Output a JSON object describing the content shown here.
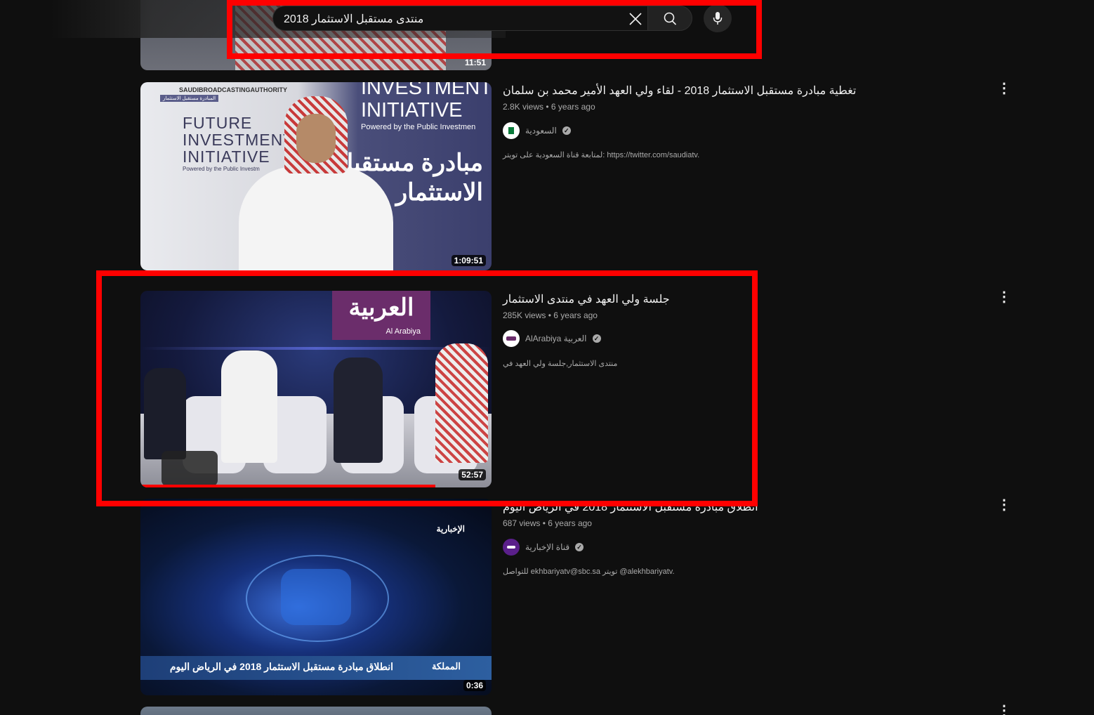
{
  "search": {
    "query": "منتدى مستقبل الاستثمار 2018",
    "clear_icon": "close-icon",
    "search_icon": "search-icon",
    "mic_icon": "microphone-icon"
  },
  "results": [
    {
      "duration": "11:51"
    },
    {
      "title": "تغطية مبادرة مستقبل الاستثمار 2018 - لقاء ولي العهد الأمير محمد بن سلمان",
      "views": "2.8K views",
      "age": "6 years ago",
      "channel": "السعودية",
      "description": "لمتابعة قناة السعودية على تويتر: https://twitter.com/saudiatv.",
      "duration": "1:09:51",
      "thumb_text": {
        "authority": "SAUDIBROADCASTINGAUTHORITY",
        "tag": "المبادرة مستقبل الاستثمار",
        "fii_en_1": "FUTURE",
        "fii_en_2": "INVESTMENT",
        "fii_en_3": "INITIATIVE",
        "fii_powered": "Powered by the Public Investm",
        "right_en_1": "INVESTMENT",
        "right_en_2": "INITIATIVE",
        "right_powered": "Powered by the Public Investmen",
        "right_ar_1": "مبادرة مستقبل",
        "right_ar_2": "الاستثمار"
      }
    },
    {
      "title": "جلسة ولي العهد في منتدى الاستثمار",
      "views": "285K views",
      "age": "6 years ago",
      "channel": "AlArabiya العربية",
      "description": "منتدى الاستثمار,جلسة ولي العهد في",
      "duration": "52:57",
      "progress": 0.84,
      "thumb_text": {
        "logo_ar": "العربية",
        "logo_en": "Al Arabiya"
      }
    },
    {
      "title": "انطلاق مبادرة مستقبل الاستثمار 2018 في الرياض اليوم",
      "views": "687 views",
      "age": "6 years ago",
      "channel": "قناة الإخبارية",
      "description": "للتواصل ekhbariyatv@sbc.sa تويتر @alekhbariyatv.",
      "duration": "0:36",
      "thumb_text": {
        "logo": "الإخبارية",
        "caption": "انطلاق مبادرة مستقبل الاستثمار 2018 في الرياض اليوم",
        "corner": "المملكة"
      }
    }
  ],
  "colors": {
    "annotation": "#ff0000",
    "background": "#0f0f0f",
    "secondary_text": "#aaaaaa"
  }
}
